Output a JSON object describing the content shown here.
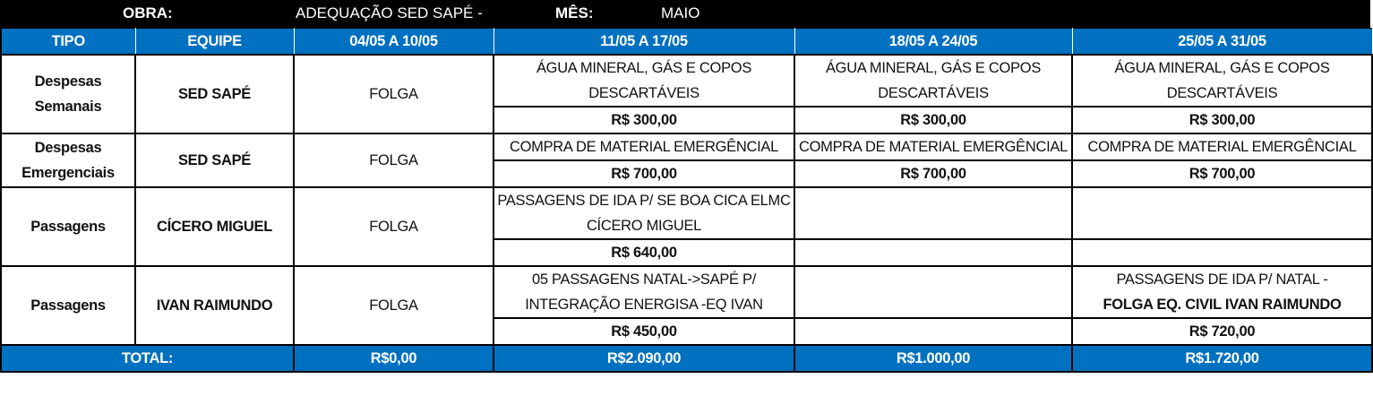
{
  "header": {
    "obra_label": "OBRA:",
    "obra_value": "ADEQUAÇÃO SED SAPÉ -",
    "mes_label": "MÊS:",
    "mes_value": "MAIO"
  },
  "columns": [
    "TIPO",
    "EQUIPE",
    "04/05 A 10/05",
    "11/05 A 17/05",
    "18/05 A 24/05",
    "25/05 A 31/05"
  ],
  "rows": [
    {
      "tipo": "Despesas Semanais",
      "equipe": "SED SAPÉ",
      "w1": "FOLGA",
      "w2_desc": "ÁGUA MINERAL, GÁS E COPOS DESCARTÁVEIS",
      "w2_val": "R$ 300,00",
      "w3_desc": "ÁGUA MINERAL, GÁS E COPOS DESCARTÁVEIS",
      "w3_val": "R$ 300,00",
      "w4_desc": "ÁGUA MINERAL, GÁS E COPOS DESCARTÁVEIS",
      "w4_val": "R$ 300,00"
    },
    {
      "tipo": "Despesas Emergenciais",
      "equipe": "SED SAPÉ",
      "w1": "FOLGA",
      "w2_desc": "COMPRA DE MATERIAL EMERGÊNCIAL",
      "w2_val": "R$ 700,00",
      "w3_desc": "COMPRA DE MATERIAL EMERGÊNCIAL",
      "w3_val": "R$ 700,00",
      "w4_desc": "COMPRA DE MATERIAL EMERGÊNCIAL",
      "w4_val": "R$ 700,00"
    },
    {
      "tipo": "Passagens",
      "equipe": "CÍCERO MIGUEL",
      "w1": "FOLGA",
      "w2_desc": "PASSAGENS DE IDA P/ SE BOA CICA ELMC CÍCERO MIGUEL",
      "w2_val": "R$ 640,00",
      "w3_desc": "",
      "w3_val": "",
      "w4_desc": "",
      "w4_val": ""
    },
    {
      "tipo": "Passagens",
      "equipe": "IVAN RAIMUNDO",
      "w1": "FOLGA",
      "w2_desc": "05 PASSAGENS NATAL->SAPÉ P/ INTEGRAÇÃO ENERGISA -EQ IVAN",
      "w2_val": "R$ 450,00",
      "w3_desc": "",
      "w3_val": "",
      "w4_desc": "PASSAGENS DE IDA P/ NATAL -",
      "w4_desc_bold": "FOLGA  EQ. CIVIL IVAN RAIMUNDO",
      "w4_val": "R$ 720,00"
    }
  ],
  "total": {
    "label": "TOTAL:",
    "w1": "R$0,00",
    "w2": "R$2.090,00",
    "w3": "R$1.000,00",
    "w4": "R$1.720,00"
  },
  "colors": {
    "header_blue": "#0070C0",
    "title_bar": "#000000"
  }
}
